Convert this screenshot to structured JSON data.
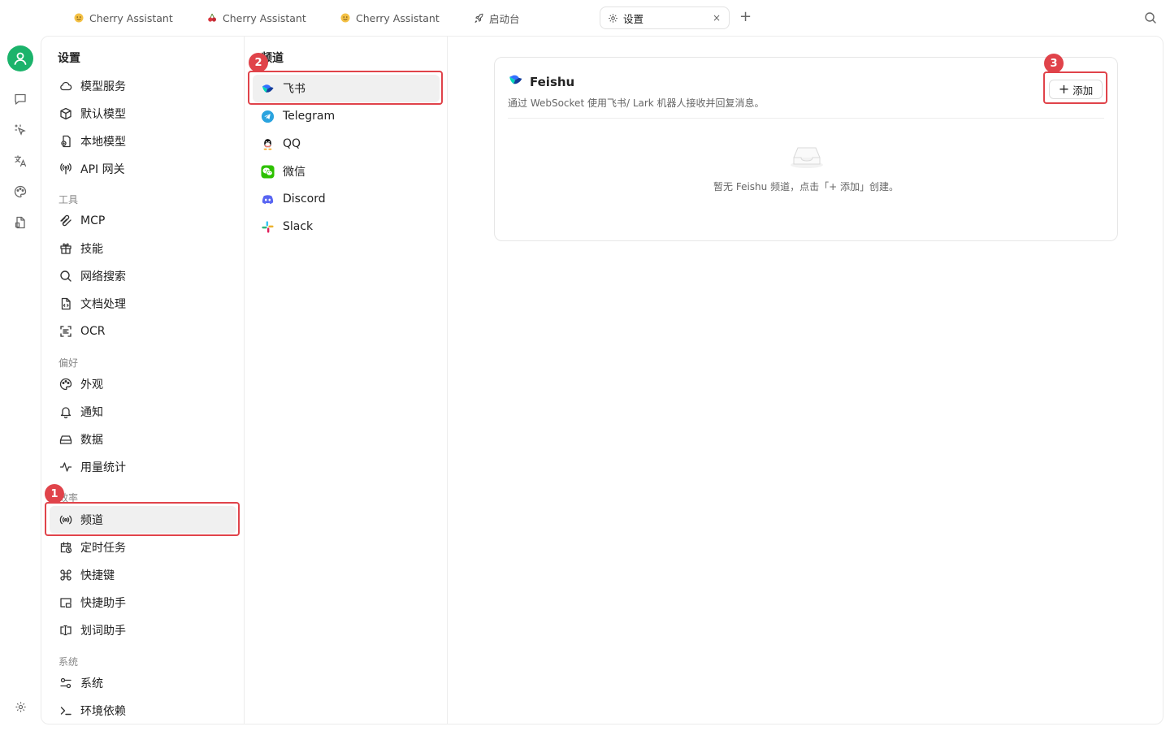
{
  "tabs": [
    {
      "label": "Cherry Assistant",
      "icon": "emoji-face-icon"
    },
    {
      "label": "Cherry Assistant",
      "icon": "cherry-icon"
    },
    {
      "label": "Cherry Assistant",
      "icon": "emoji-face-icon"
    },
    {
      "label": "启动台",
      "icon": "rocket-icon"
    },
    {
      "label": "设置",
      "icon": "gear-icon",
      "active": true,
      "close": "×"
    }
  ],
  "tab_add": "+",
  "settings": {
    "title": "设置",
    "items_top": [
      {
        "label": "模型服务",
        "icon": "cloud-icon"
      },
      {
        "label": "默认模型",
        "icon": "cube-icon"
      },
      {
        "label": "本地模型",
        "icon": "local-model-icon"
      },
      {
        "label": "API 网关",
        "icon": "antenna-icon"
      }
    ],
    "group_tools": "工具",
    "items_tools": [
      {
        "label": "MCP",
        "icon": "mcp-icon"
      },
      {
        "label": "技能",
        "icon": "gift-icon"
      },
      {
        "label": "网络搜索",
        "icon": "search-icon"
      },
      {
        "label": "文档处理",
        "icon": "document-code-icon"
      },
      {
        "label": "OCR",
        "icon": "scan-text-icon"
      }
    ],
    "group_prefs": "偏好",
    "items_prefs": [
      {
        "label": "外观",
        "icon": "palette-icon"
      },
      {
        "label": "通知",
        "icon": "bell-icon"
      },
      {
        "label": "数据",
        "icon": "hard-drive-icon"
      },
      {
        "label": "用量统计",
        "icon": "activity-icon"
      }
    ],
    "group_efficiency": "效率",
    "items_efficiency": [
      {
        "label": "频道",
        "icon": "radio-broadcast-icon",
        "selected": true
      },
      {
        "label": "定时任务",
        "icon": "calendar-clock-icon"
      },
      {
        "label": "快捷键",
        "icon": "command-icon"
      },
      {
        "label": "快捷助手",
        "icon": "app-window-icon"
      },
      {
        "label": "划词助手",
        "icon": "text-select-icon"
      }
    ],
    "group_system": "系统",
    "items_system": [
      {
        "label": "系统",
        "icon": "sliders-icon"
      },
      {
        "label": "环境依赖",
        "icon": "terminal-icon"
      }
    ]
  },
  "channels": {
    "title": "频道",
    "items": [
      {
        "label": "飞书",
        "icon": "feishu-icon",
        "selected": true
      },
      {
        "label": "Telegram",
        "icon": "telegram-icon"
      },
      {
        "label": "QQ",
        "icon": "qq-icon"
      },
      {
        "label": "微信",
        "icon": "wechat-icon"
      },
      {
        "label": "Discord",
        "icon": "discord-icon"
      },
      {
        "label": "Slack",
        "icon": "slack-icon"
      }
    ]
  },
  "detail": {
    "title": "Feishu",
    "description": "通过 WebSocket 使用飞书/ Lark 机器人接收并回复消息。",
    "add_label": "添加",
    "add_icon": "+",
    "empty_text": "暂无 Feishu 频道，点击「+ 添加」创建。"
  },
  "annotations": [
    "1",
    "2",
    "3"
  ],
  "colors": {
    "highlight": "#e0434a",
    "avatar": "#1bb36b",
    "selected_bg": "#f0f0f0"
  }
}
